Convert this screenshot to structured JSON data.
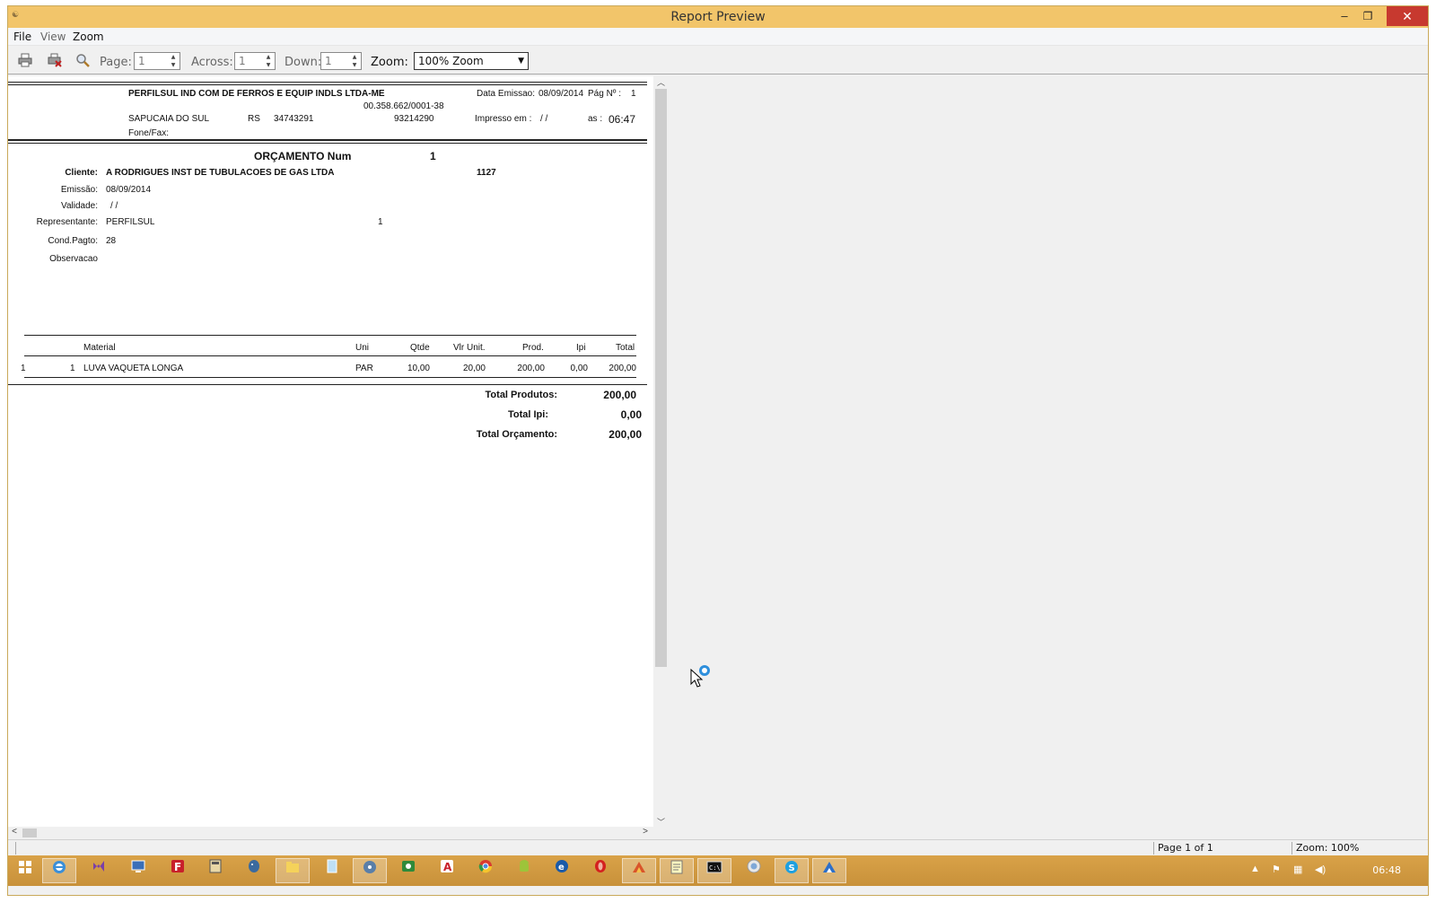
{
  "window": {
    "title": "Report Preview",
    "min_glyph": "‒",
    "max_glyph": "❐",
    "close_glyph": "✕"
  },
  "menu": {
    "file": "File",
    "view": "View",
    "zoom": "Zoom"
  },
  "toolbar": {
    "page_label": "Page:",
    "page_value": "1",
    "across_label": "Across:",
    "across_value": "1",
    "down_label": "Down:",
    "down_value": "1",
    "zoom_label": "Zoom:",
    "zoom_value": "100% Zoom"
  },
  "report": {
    "company": "PERFILSUL IND COM DE FERROS E EQUIP INDLS  LTDA-ME",
    "cnpj": "00.358.662/0001-38",
    "data_emissao_label": "Data Emissao:",
    "data_emissao": "08/09/2014",
    "pag_label": "Pág Nº :",
    "pag_value": "1",
    "city": "SAPUCAIA DO SUL",
    "state": "RS",
    "phone": "34743291",
    "zip": "93214290",
    "impresso_label": "Impresso em :",
    "impresso_value": "/ /",
    "as_label": "as :",
    "time": "06:47",
    "fone_fax_label": "Fone/Fax:",
    "orcamento_label": "ORÇAMENTO Num",
    "orcamento_num": "1",
    "cliente_label": "Cliente:",
    "cliente": "A RODRIGUES INST DE TUBULACOES DE GAS LTDA",
    "cliente_code": "1127",
    "emissao_label": "Emissão:",
    "emissao": "08/09/2014",
    "validade_label": "Validade:",
    "validade": "/ /",
    "representante_label": "Representante:",
    "representante": "PERFILSUL",
    "representante_code": "1",
    "cond_pagto_label": "Cond.Pagto:",
    "cond_pagto": "28",
    "observacao_label": "Observacao",
    "columns": {
      "material": "Material",
      "uni": "Uni",
      "qtde": "Qtde",
      "vlr_unit": "Vlr Unit.",
      "prod": "Prod.",
      "ipi": "Ipi",
      "total": "Total"
    },
    "items": [
      {
        "seq": "1",
        "code": "1",
        "material": "LUVA  VAQUETA LONGA",
        "uni": "PAR",
        "qtde": "10,00",
        "vlr_unit": "20,00",
        "prod": "200,00",
        "ipi": "0,00",
        "total": "200,00"
      }
    ],
    "total_produtos_label": "Total Produtos:",
    "total_produtos": "200,00",
    "total_ipi_label": "Total Ipi:",
    "total_ipi": "0,00",
    "total_orcamento_label": "Total Orçamento:",
    "total_orcamento": "200,00"
  },
  "statusbar": {
    "page": "Page 1 of 1",
    "zoom": "Zoom: 100%"
  },
  "taskbar": {
    "clock": "06:48",
    "apps": [
      "windows-start-icon",
      "internet-explorer-icon",
      "visual-studio-icon",
      "remote-desktop-icon",
      "filezilla-icon",
      "calculator-icon",
      "postgresql-icon",
      "file-explorer-icon",
      "notepad-icon",
      "disk-utility-icon",
      "network-app-icon",
      "acrobat-icon",
      "chrome-icon",
      "android-icon",
      "ie-blue-icon",
      "opera-icon",
      "delphi-icon",
      "notes-icon",
      "command-prompt-icon",
      "circle-app-icon",
      "skype-icon",
      "report-app-icon"
    ]
  }
}
